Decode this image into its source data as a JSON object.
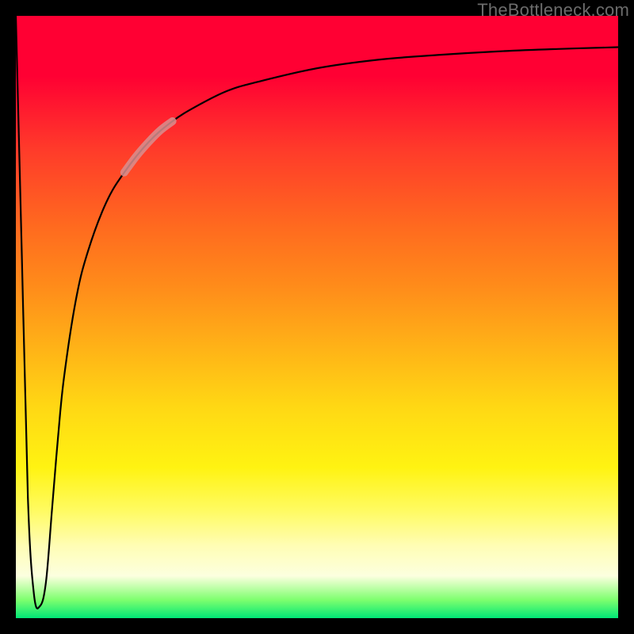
{
  "watermark": "TheBottleneck.com",
  "chart_data": {
    "type": "line",
    "title": "",
    "xlabel": "",
    "ylabel": "",
    "xlim": [
      0,
      100
    ],
    "ylim": [
      0,
      100
    ],
    "grid": false,
    "legend": false,
    "series": [
      {
        "name": "bottleneck-curve",
        "color": "#000000",
        "x": [
          0,
          1,
          2,
          3,
          4,
          5,
          6,
          7,
          8,
          10,
          12,
          15,
          18,
          22,
          26,
          30,
          35,
          40,
          50,
          60,
          70,
          80,
          90,
          100
        ],
        "y": [
          100,
          60,
          20,
          4,
          2,
          6,
          18,
          30,
          40,
          53,
          61,
          69,
          74,
          79,
          82.5,
          85,
          87.5,
          89,
          91.3,
          92.7,
          93.5,
          94.1,
          94.5,
          94.8
        ]
      },
      {
        "name": "highlight-segment",
        "color": "#d88f8f",
        "x": [
          18,
          20,
          22,
          24,
          26
        ],
        "y": [
          74,
          76.7,
          79,
          81,
          82.5
        ]
      }
    ],
    "background_gradient": {
      "stops": [
        {
          "pos": 0.0,
          "color": "#ff0033"
        },
        {
          "pos": 0.1,
          "color": "#ff0033"
        },
        {
          "pos": 0.22,
          "color": "#ff3a2a"
        },
        {
          "pos": 0.35,
          "color": "#ff6a1f"
        },
        {
          "pos": 0.45,
          "color": "#ff8c1a"
        },
        {
          "pos": 0.55,
          "color": "#ffb217"
        },
        {
          "pos": 0.65,
          "color": "#ffd814"
        },
        {
          "pos": 0.75,
          "color": "#fff312"
        },
        {
          "pos": 0.82,
          "color": "#fffb60"
        },
        {
          "pos": 0.88,
          "color": "#fffdb5"
        },
        {
          "pos": 0.93,
          "color": "#fcffdf"
        },
        {
          "pos": 0.97,
          "color": "#7dff6e"
        },
        {
          "pos": 1.0,
          "color": "#00e676"
        }
      ]
    }
  }
}
